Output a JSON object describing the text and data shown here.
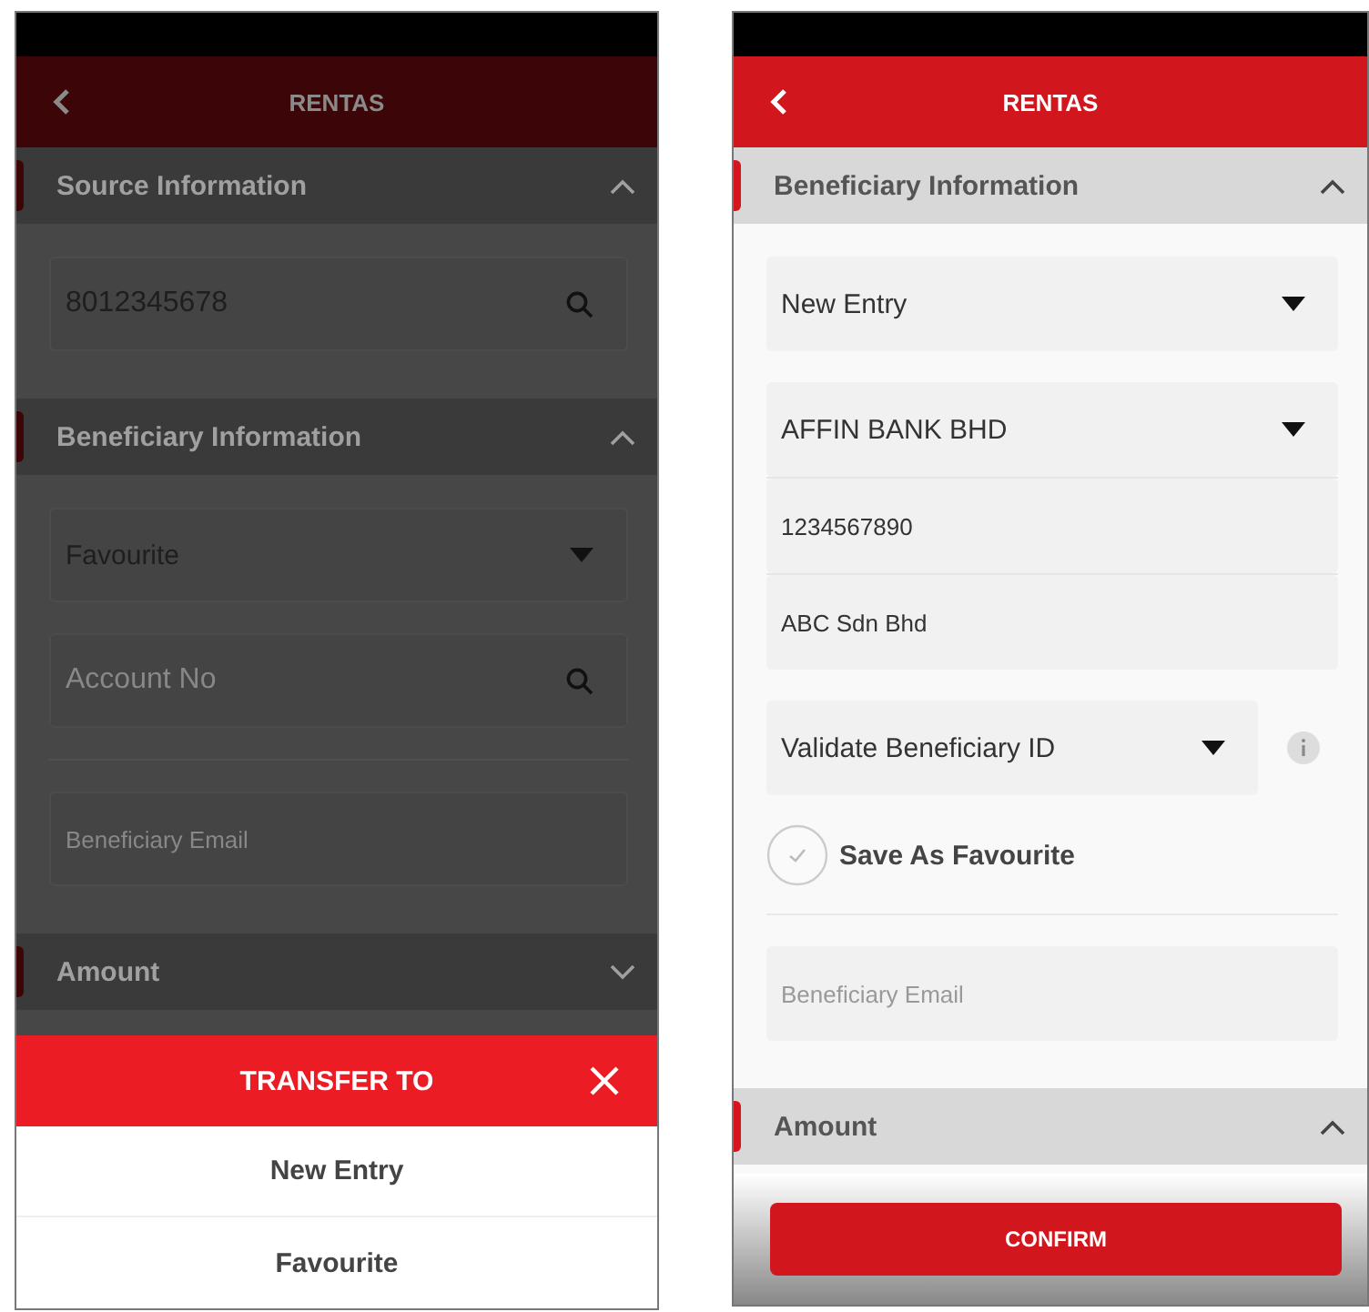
{
  "screens": [
    {
      "dimmed": true,
      "header": {
        "title": "RENTAS"
      },
      "sections": [
        {
          "title": "Source Information",
          "expanded": true,
          "fields": [
            {
              "kind": "search",
              "value": "8012345678"
            }
          ]
        },
        {
          "title": "Beneficiary Information",
          "expanded": true,
          "fields": [
            {
              "kind": "dropdown",
              "value": "Favourite"
            },
            {
              "kind": "search",
              "placeholder": "Account No"
            },
            {
              "kind": "text",
              "placeholder": "Beneficiary Email"
            }
          ]
        },
        {
          "title": "Amount",
          "expanded": false
        }
      ],
      "sheet": {
        "title": "TRANSFER TO",
        "options": [
          "New Entry",
          "Favourite"
        ]
      }
    },
    {
      "dimmed": false,
      "header": {
        "title": "RENTAS"
      },
      "sections": [
        {
          "title": "Beneficiary Information",
          "expanded": true,
          "fields": [
            {
              "kind": "dropdown",
              "value": "New Entry"
            },
            {
              "kind": "dropdown",
              "value": "AFFIN BANK BHD"
            },
            {
              "kind": "text",
              "value": "1234567890"
            },
            {
              "kind": "text",
              "value": "ABC Sdn Bhd"
            },
            {
              "kind": "dropdown",
              "value": "Validate Beneficiary ID",
              "info": true
            },
            {
              "kind": "checkbox",
              "label": "Save As Favourite",
              "checked": false
            },
            {
              "kind": "text",
              "placeholder": "Beneficiary Email"
            }
          ]
        },
        {
          "title": "Amount",
          "expanded": true
        }
      ],
      "confirm_button": "CONFIRM"
    }
  ]
}
